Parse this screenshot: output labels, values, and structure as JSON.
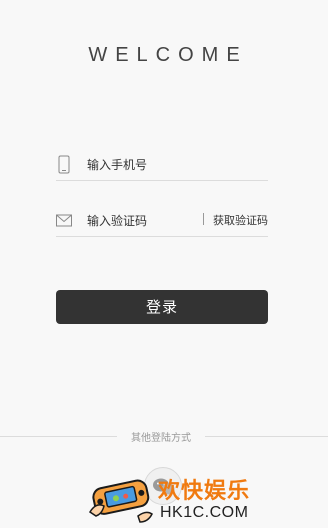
{
  "header": {
    "title": "WELCOME"
  },
  "form": {
    "phone_placeholder": "输入手机号",
    "code_placeholder": "输入验证码",
    "get_code_label": "获取验证码",
    "login_label": "登录"
  },
  "other_login": {
    "label": "其他登陆方式",
    "providers": [
      {
        "icon": "wechat-icon"
      }
    ]
  },
  "watermark": {
    "text_cn": "欢快娱乐",
    "text_en": "HK1C.COM"
  },
  "colors": {
    "background": "#f8f8f8",
    "button": "#333333",
    "watermark_orange": "#f07a10"
  }
}
